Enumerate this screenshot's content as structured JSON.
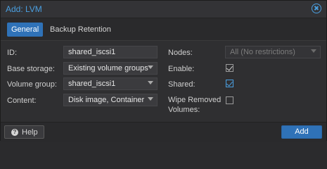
{
  "dialog": {
    "title": "Add: LVM"
  },
  "tabs": [
    {
      "label": "General",
      "active": true
    },
    {
      "label": "Backup Retention",
      "active": false
    }
  ],
  "left": {
    "id_label": "ID:",
    "id_value": "shared_iscsi1",
    "base_storage_label": "Base storage:",
    "base_storage_value": "Existing volume groups",
    "volume_group_label": "Volume group:",
    "volume_group_value": "shared_iscsi1",
    "content_label": "Content:",
    "content_value": "Disk image, Container"
  },
  "right": {
    "nodes_label": "Nodes:",
    "nodes_value": "All (No restrictions)",
    "enable_label": "Enable:",
    "enable_checked": true,
    "shared_label": "Shared:",
    "shared_checked": true,
    "wipe_label_line1": "Wipe Removed",
    "wipe_label_line2": "Volumes:",
    "wipe_checked": false
  },
  "footer": {
    "help_label": "Help",
    "add_label": "Add"
  },
  "colors": {
    "accent": "#2f72b8",
    "title": "#4a9fe0"
  }
}
